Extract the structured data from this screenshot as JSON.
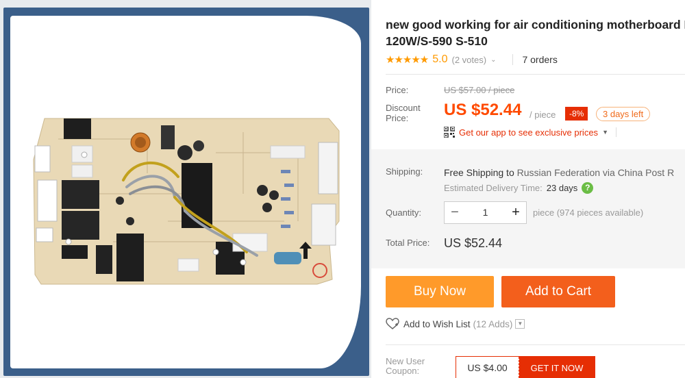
{
  "product": {
    "title_line1": "new good working for air conditioning motherboard K",
    "title_line2": "120W/S-590 S-510"
  },
  "rating": {
    "stars": "★★★★★",
    "score": "5.0",
    "votes": "(2 votes)",
    "orders": "7 orders"
  },
  "price": {
    "label": "Price:",
    "original": "US $57.00 / piece",
    "discount_label": "Discount Price:",
    "discount": "US $52.44",
    "per_piece": "/ piece",
    "percent_off": "-8%",
    "days_left": "3 days left",
    "app_promo": "Get our app to see exclusive prices"
  },
  "shipping": {
    "label": "Shipping:",
    "free": "Free Shipping to",
    "destination": "Russian Federation via China Post R",
    "eta_label": "Estimated Delivery Time:",
    "eta_value": "23 days",
    "help": "?"
  },
  "quantity": {
    "label": "Quantity:",
    "minus": "−",
    "value": "1",
    "plus": "+",
    "available": "piece (974 pieces available)"
  },
  "total": {
    "label": "Total Price:",
    "value": "US $52.44"
  },
  "actions": {
    "buy_now": "Buy Now",
    "add_to_cart": "Add to Cart",
    "wish_list": "Add to Wish List",
    "wish_adds": "(12 Adds)"
  },
  "coupon": {
    "label": "New User Coupon:",
    "amount": "US $4.00",
    "cta": "GET IT NOW"
  },
  "colors": {
    "accent_orange": "#ff4a00",
    "buy_now": "#ff9a2a",
    "add_to_cart": "#f35f1c",
    "badge_red": "#e62e04",
    "star": "#ff9a00",
    "gallery_frame": "#3b5f8a"
  },
  "icons": {
    "rating": "star-icon",
    "qr": "qr-code-icon",
    "help": "help-icon",
    "wish": "heart-icon"
  }
}
